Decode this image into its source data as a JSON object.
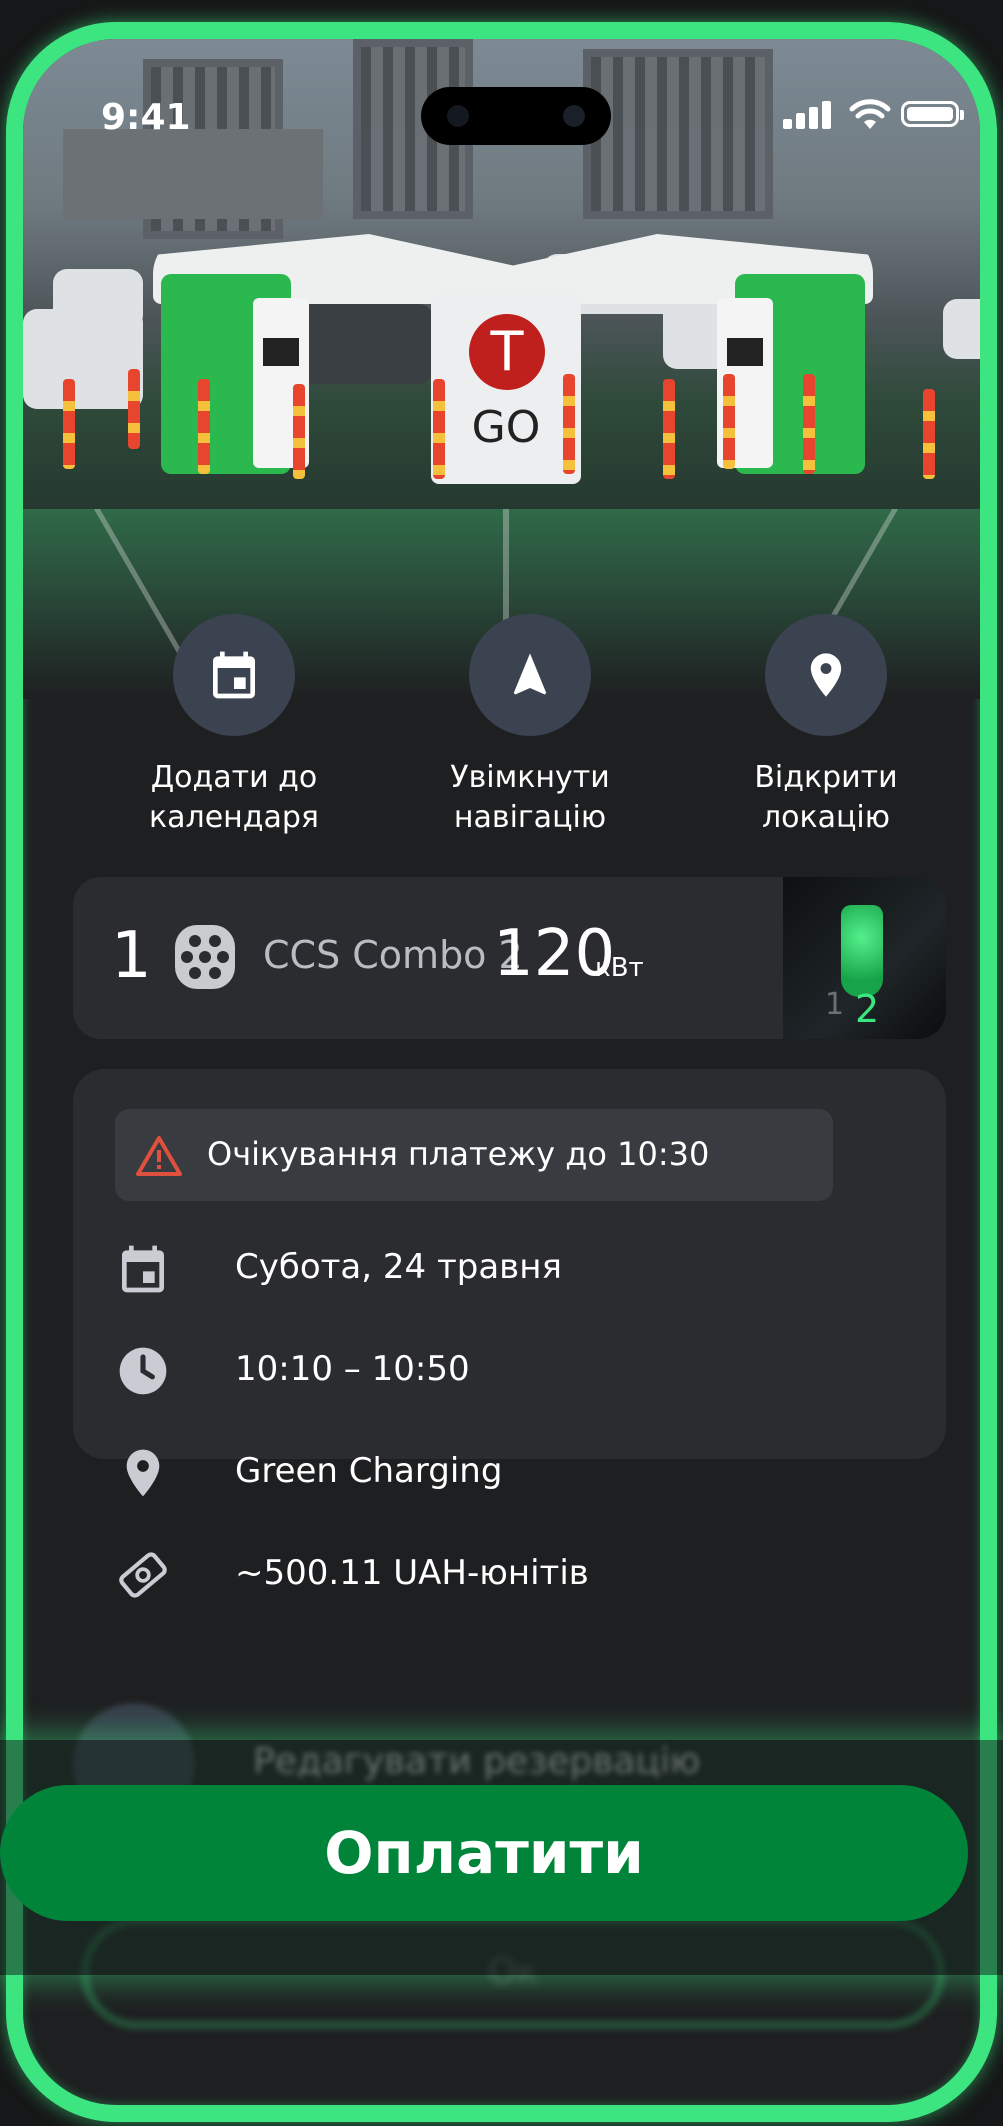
{
  "status_bar": {
    "time": "9:41"
  },
  "hero": {
    "brand_text": "GO"
  },
  "actions": [
    {
      "label": "Додати до календаря",
      "icon": "calendar-icon"
    },
    {
      "label": "Увімкнути навігацію",
      "icon": "navigation-arrow-icon"
    },
    {
      "label": "Відкрити локацію",
      "icon": "location-pin-icon"
    }
  ],
  "connector": {
    "number": "1",
    "type": "CCS Combo 2",
    "power": "120",
    "unit": "кВт",
    "photo_labels": [
      "1",
      "2"
    ]
  },
  "details": {
    "warning": "Очікування платежу до 10:30",
    "date": "Субота, 24 травня",
    "time_range": "10:10 – 10:50",
    "location": "Green Charging",
    "cost": "~500.11 UAH-юнітів"
  },
  "edit": {
    "label": "Редагувати резервацію"
  },
  "ok": {
    "label": "Ок"
  },
  "pay": {
    "label": "Оплатити"
  },
  "colors": {
    "accent": "#3de580",
    "pay_button": "#00843a",
    "card": "#2a2c30",
    "warning": "#e0503f"
  }
}
